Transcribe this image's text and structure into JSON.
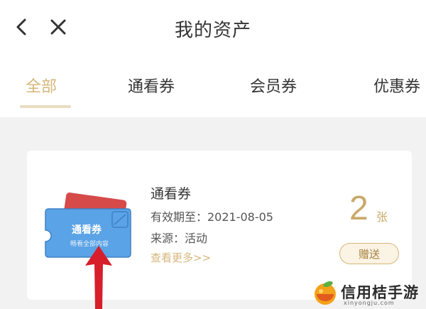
{
  "header": {
    "title": "我的资产"
  },
  "tabs": [
    {
      "label": "全部",
      "active": true
    },
    {
      "label": "通看券",
      "active": false
    },
    {
      "label": "会员券",
      "active": false
    },
    {
      "label": "优惠券",
      "active": false
    }
  ],
  "card": {
    "name": "通看券",
    "validity": "有效期至：2021-08-05",
    "source": "来源：活动",
    "more_link": "查看更多>>",
    "count": "2",
    "unit": "张",
    "gift_label": "赠送",
    "ticket_title": "通看券",
    "ticket_subtitle": "畅看全部内容"
  },
  "watermark": {
    "text": "信用桔手游",
    "url": "xinyongju.com"
  },
  "colors": {
    "accent": "#d6b67a",
    "ticket_blue": "#5aa3e6",
    "ticket_red": "#d64a4a",
    "arrow": "#d61f2a"
  }
}
